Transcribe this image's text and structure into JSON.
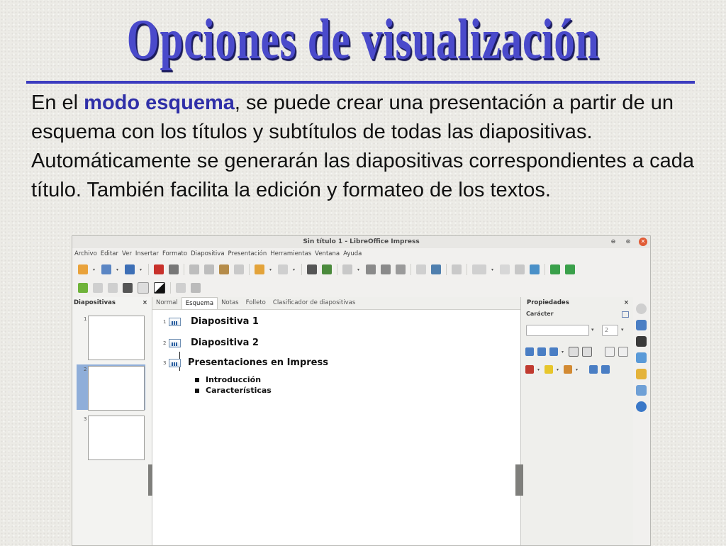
{
  "slide": {
    "title": "Opciones de visualización",
    "body_intro": "En el ",
    "body_keyword": "modo esquema",
    "body_rest": ", se puede crear una presentación a partir de un esquema con los títulos y subtítulos de todas las diapositivas.  Automáticamente se generarán las diapositivas correspondientes a cada título.  También facilita la edición y formateo de los textos."
  },
  "app": {
    "window_title": "Sin título 1 - LibreOffice Impress",
    "window_buttons": [
      "⊖",
      "⊙",
      "✕"
    ],
    "menu": [
      "Archivo",
      "Editar",
      "Ver",
      "Insertar",
      "Formato",
      "Diapositiva",
      "Presentación",
      "Herramientas",
      "Ventana",
      "Ayuda"
    ],
    "slides_pane": {
      "title": "Diapositivas",
      "close": "×",
      "slide_numbers": [
        "1",
        "2",
        "3"
      ],
      "selected_slide": 2
    },
    "view_tabs": [
      "Normal",
      "Esquema",
      "Notas",
      "Folleto",
      "Clasificador de diapositivas"
    ],
    "active_tab": "Esquema",
    "outline": [
      {
        "num": "1",
        "title": "Diapositiva 1"
      },
      {
        "num": "2",
        "title": "Diapositiva 2"
      },
      {
        "num": "3",
        "title": "Presentaciones en Impress"
      }
    ],
    "bullets": [
      "Introducción",
      "Características"
    ],
    "properties": {
      "title": "Propiedades",
      "close": "×",
      "section": "Carácter",
      "font_size": "2"
    }
  }
}
